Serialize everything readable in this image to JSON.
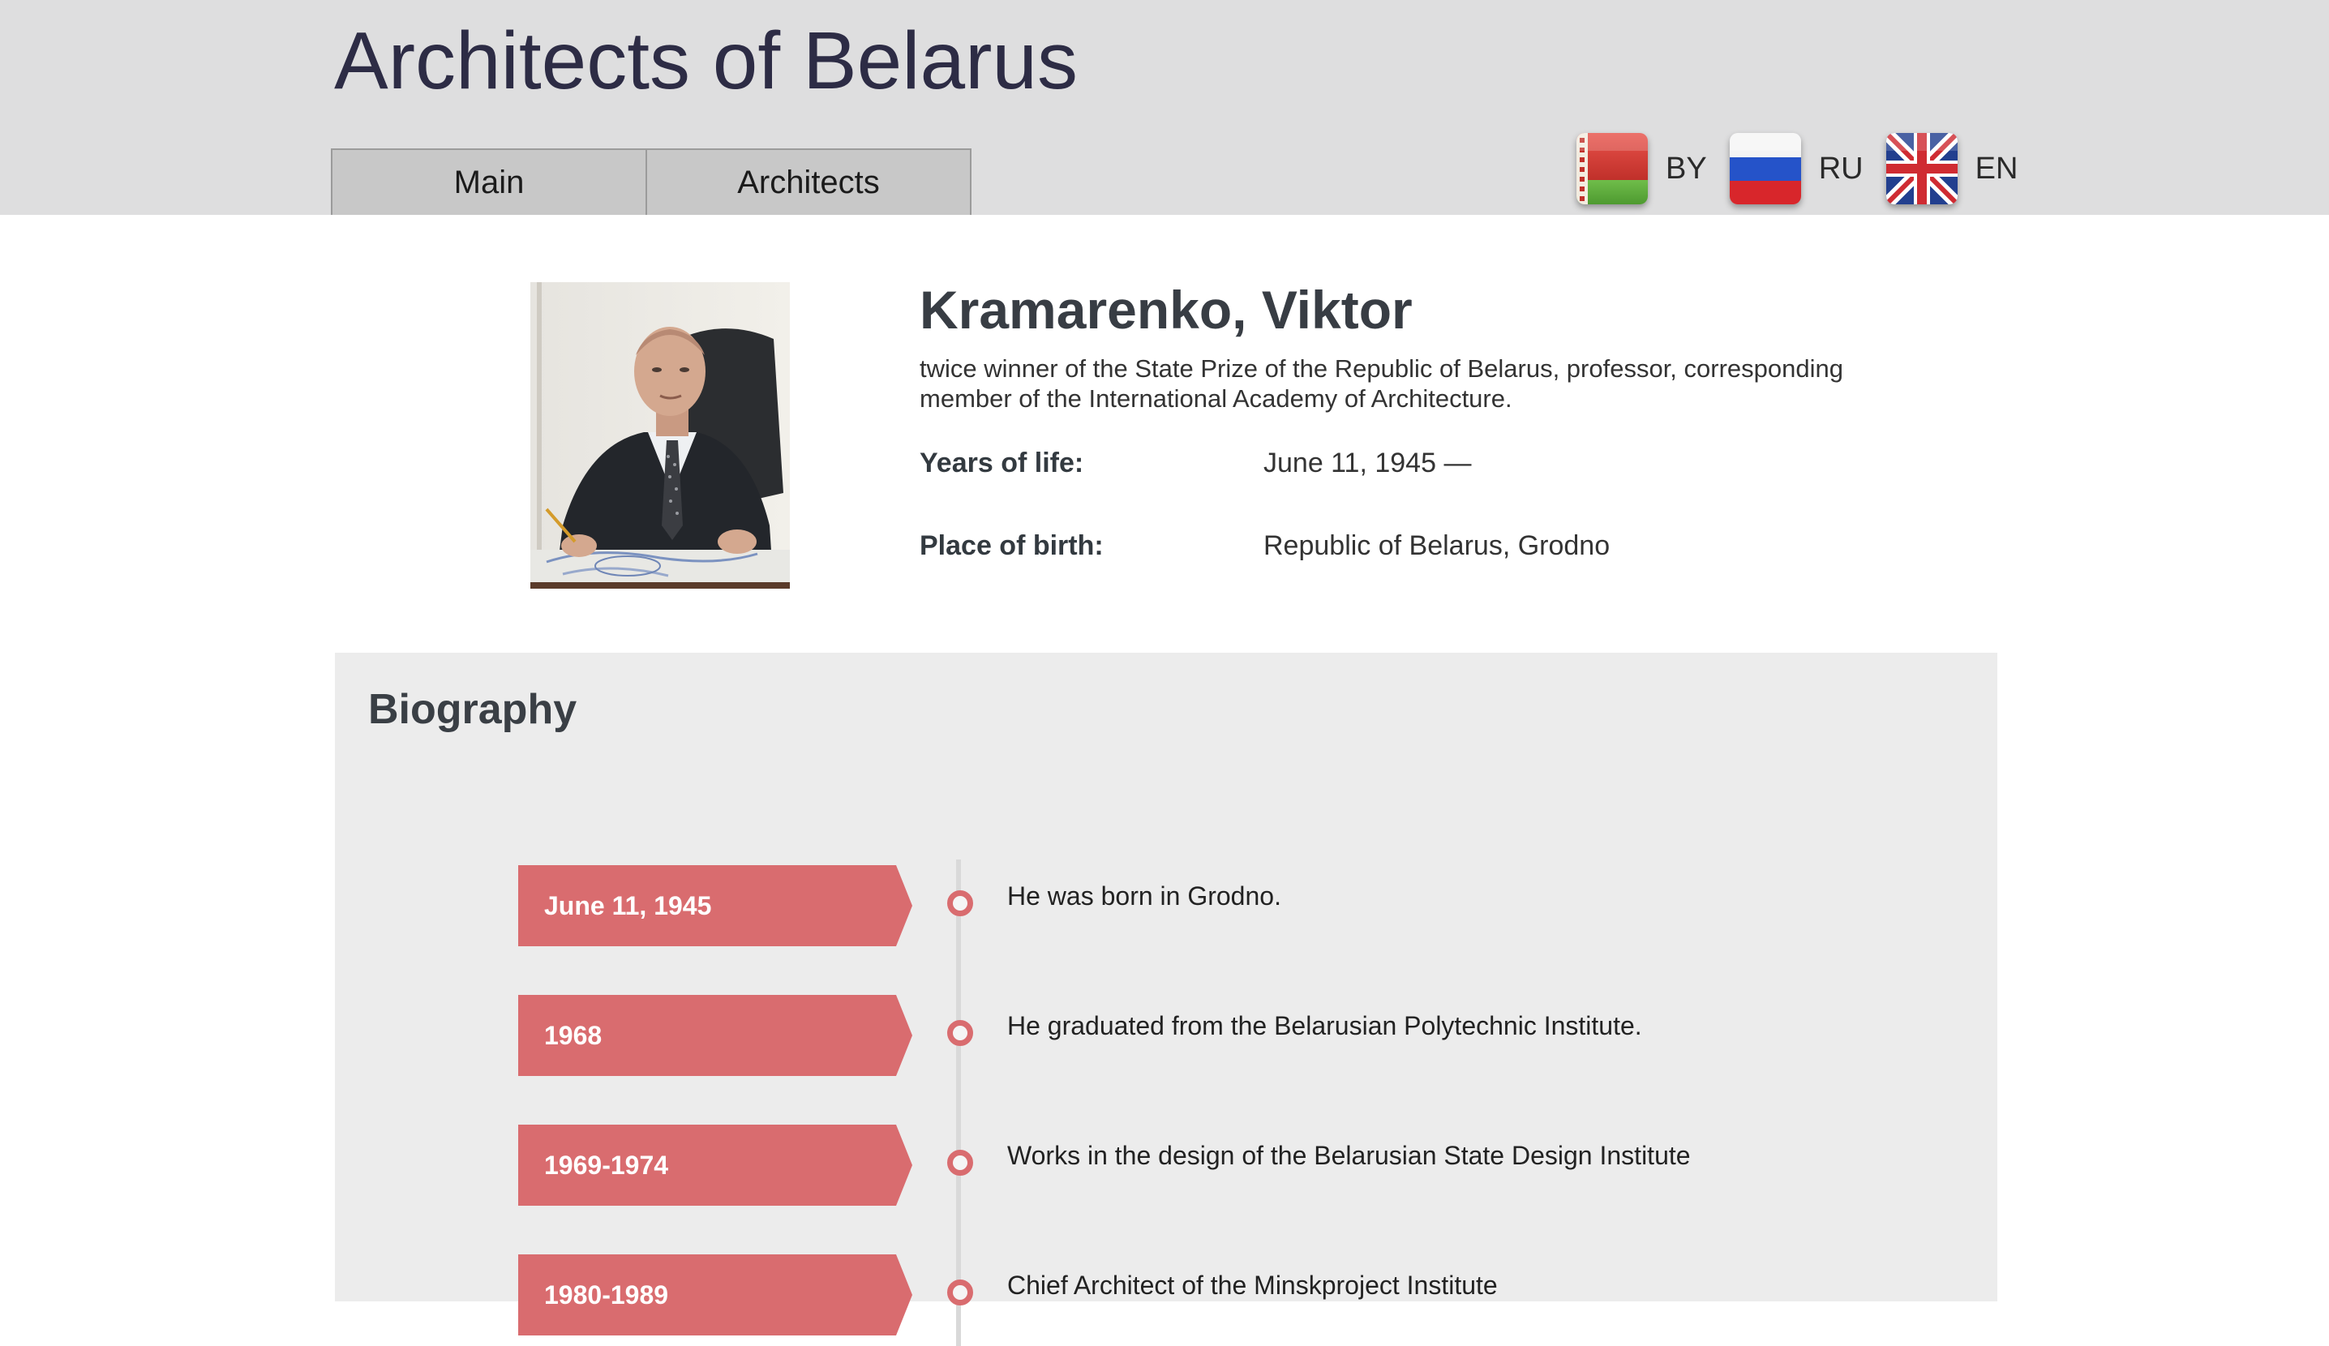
{
  "site": {
    "title": "Architects of Belarus"
  },
  "nav": {
    "tabs": [
      {
        "label": "Main"
      },
      {
        "label": "Architects"
      }
    ]
  },
  "languages": [
    {
      "code": "BY",
      "flag_icon": "belarus-flag-icon"
    },
    {
      "code": "RU",
      "flag_icon": "russia-flag-icon"
    },
    {
      "code": "EN",
      "flag_icon": "uk-flag-icon"
    }
  ],
  "profile": {
    "name": "Kramarenko, Viktor",
    "subtitle": "twice winner of the State Prize of the Republic of Belarus, professor, corresponding member of the International Academy of Architecture.",
    "fields": [
      {
        "label": "Years of life:",
        "value": "June 11, 1945 —"
      },
      {
        "label": "Place of birth:",
        "value": "Republic of Belarus, Grodno"
      }
    ]
  },
  "biography": {
    "title": "Biography",
    "events": [
      {
        "date": "June 11, 1945",
        "text": "He was born in Grodno."
      },
      {
        "date": "1968",
        "text": "He graduated from the Belarusian Polytechnic Institute."
      },
      {
        "date": "1969-1974",
        "text": "Works in the design of the Belarusian State Design Institute"
      },
      {
        "date": "1980-1989",
        "text": "Chief Architect of the Minskproject Institute"
      }
    ]
  },
  "colors": {
    "header_bg": "#dededf",
    "accent": "#d96c6f",
    "bio_bg": "#ececec",
    "title_text": "#2d2c45"
  }
}
